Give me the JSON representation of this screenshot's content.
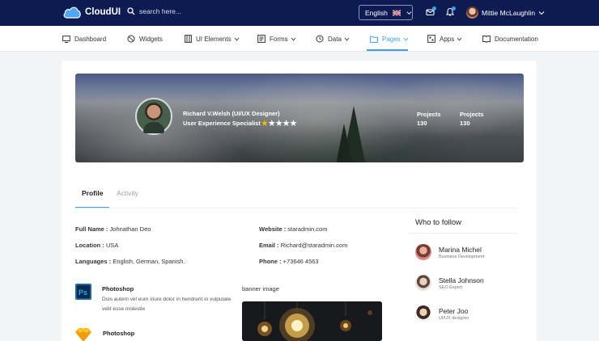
{
  "app": {
    "name": "CloudUI"
  },
  "search": {
    "placeholder": "search here..."
  },
  "language": {
    "label": "English"
  },
  "user": {
    "name": "Mittie McLaughlin"
  },
  "nav": {
    "items": [
      {
        "label": "Dashboard",
        "icon": "monitor-icon"
      },
      {
        "label": "Widgets",
        "icon": "circle-slash-icon"
      },
      {
        "label": "UI Elements",
        "icon": "columns-icon",
        "dropdown": true
      },
      {
        "label": "Forms",
        "icon": "form-icon",
        "dropdown": true
      },
      {
        "label": "Data",
        "icon": "clock-icon",
        "dropdown": true
      },
      {
        "label": "Pages",
        "icon": "folder-icon",
        "dropdown": true,
        "active": true
      },
      {
        "label": "Apps",
        "icon": "apps-icon",
        "dropdown": true
      },
      {
        "label": "Documentation",
        "icon": "book-icon"
      }
    ]
  },
  "profile": {
    "name": "Richard V.Welsh (UI/UX Designer)",
    "role": "User Experience Specialist",
    "rating": 1,
    "rating_max": 5,
    "stats": [
      {
        "label": "Projects",
        "value": "130"
      },
      {
        "label": "Projects",
        "value": "130"
      }
    ]
  },
  "tabs": [
    {
      "label": "Profile",
      "active": true
    },
    {
      "label": "Activity",
      "active": false
    }
  ],
  "details": {
    "full_name_label": "Full Name :",
    "full_name": "Johnathan Deo",
    "location_label": "Location :",
    "location": "USA",
    "languages_label": "Languages :",
    "languages": "English, German, Spanish.",
    "website_label": "Website :",
    "website": "staradmin.com",
    "email_label": "Email :",
    "email": "Richard@staradmin.com",
    "phone_label": "Phone :",
    "phone": "+73646 4563"
  },
  "skills": [
    {
      "title": "Photoshop",
      "desc": "Duis autem vel eum iriure dolor in hendrerit in vulputate velit esse molestie",
      "icon": "photoshop-icon"
    },
    {
      "title": "Photoshop",
      "desc": "",
      "icon": "sketch-icon"
    }
  ],
  "media": {
    "label": "banner image"
  },
  "who_to_follow": {
    "title": "Who to follow",
    "people": [
      {
        "name": "Marina Michel",
        "role": "Business Development"
      },
      {
        "name": "Stella Johnson",
        "role": "SEO Expert"
      },
      {
        "name": "Peter Joo",
        "role": "UI/UX designer"
      }
    ]
  },
  "colors": {
    "topbar": "#0e1a52",
    "accent": "#3f9ef0",
    "star": "#f4b400"
  }
}
